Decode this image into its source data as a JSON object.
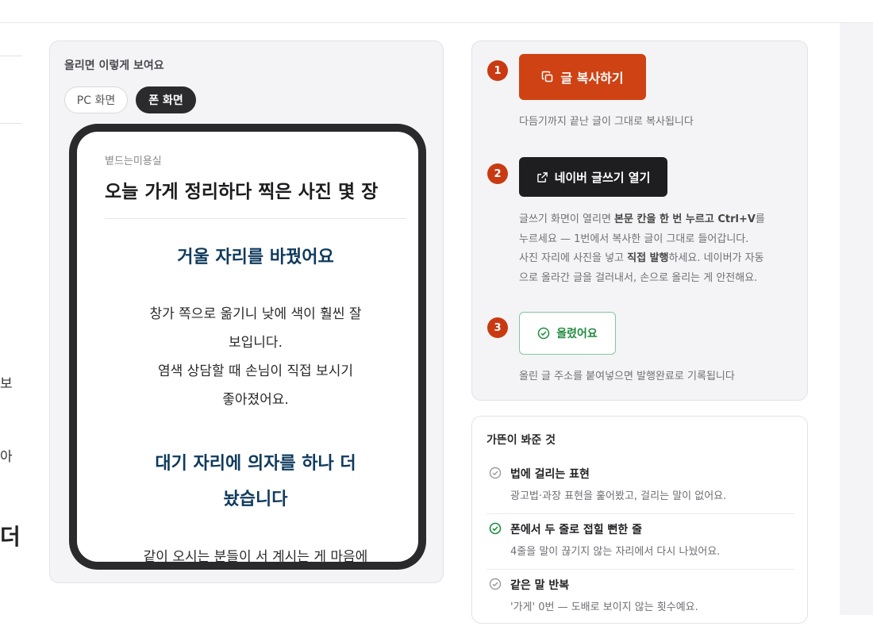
{
  "left_edge": {
    "frag_1": "보",
    "frag_2": "아",
    "frag_3": "더"
  },
  "preview": {
    "title": "올리면 이렇게 보여요",
    "toggle_pc": "PC 화면",
    "toggle_phone": "폰 화면",
    "shop_name": "볕드는미용실",
    "post_title": "오늘 가게 정리하다 찍은 사진 몇 장",
    "heading_1": "거울 자리를 바꿨어요",
    "para_1_line_1": "창가 쪽으로 옮기니 낮에 색이 훨씬 잘",
    "para_1_line_2": "보입니다.",
    "para_1_line_3": "염색 상담할 때 손님이 직접 보시기",
    "para_1_line_4": "좋아졌어요.",
    "heading_2_line_1": "대기 자리에 의자를 하나 더",
    "heading_2_line_2": "놨습니다",
    "para_2_line_1": "같이 오시는 분들이 서 계시는 게 마음에"
  },
  "steps": {
    "step_1": {
      "number": "1",
      "button": "글 복사하기",
      "button_icon": "copy-icon",
      "desc": "다듬기까지 끝난 글이 그대로 복사됩니다"
    },
    "step_2": {
      "number": "2",
      "button": "네이버 글쓰기 열기",
      "button_icon": "external-link-icon",
      "desc_l1_a": "글쓰기 화면이 열리면 ",
      "desc_l1_b": "본문 칸을 한 번 누르고 Ctrl+V",
      "desc_l1_c": "를",
      "desc_l2": "누르세요 — 1번에서 복사한 글이 그대로 들어갑니다.",
      "desc_l3_a": "사진 자리에 사진을 넣고 ",
      "desc_l3_b": "직접 발행",
      "desc_l3_c": "하세요. 네이버가 자동",
      "desc_l4": "으로 올라간 글을 걸러내서, 손으로 올리는 게 안전해요."
    },
    "step_3": {
      "number": "3",
      "button": "올렸어요",
      "button_icon": "check-circle-icon",
      "desc": "올린 글 주소를 붙여넣으면 발행완료로 기록됩니다"
    }
  },
  "review": {
    "title": "가뜬이 봐준 것",
    "items": [
      {
        "title": "법에 걸리는 표현",
        "desc": "광고법·과장 표현을 훑어봤고, 걸리는 말이 없어요.",
        "status": "grey"
      },
      {
        "title": "폰에서 두 줄로 접힐 뻔한 줄",
        "desc": "4줄을 말이 끊기지 않는 자리에서 다시 나눴어요.",
        "status": "green"
      },
      {
        "title": "같은 말 반복",
        "desc": "'가게' 0번 — 도배로 보이지 않는 횟수예요.",
        "status": "grey"
      }
    ]
  },
  "colors": {
    "accent_orange": "#cf4214",
    "step_badge": "#c93a12",
    "dark_button": "#1e1e21",
    "success_green": "#1f8a3d",
    "heading_navy": "#0f3a5c",
    "check_grey": "#9a9aa0"
  }
}
